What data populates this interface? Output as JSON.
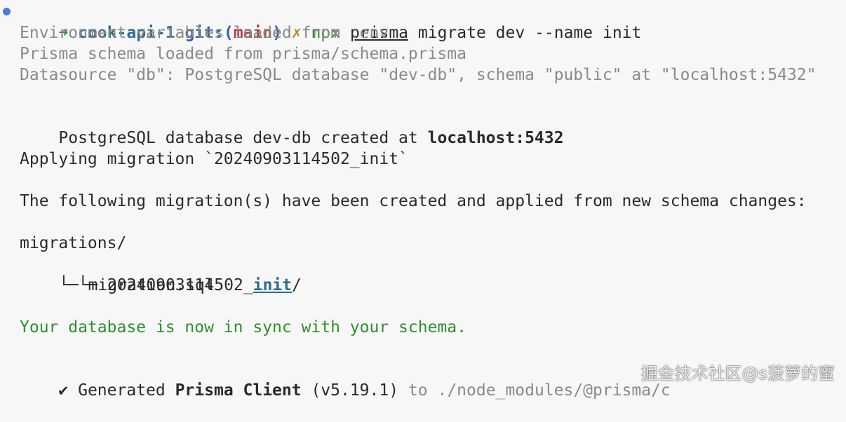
{
  "prompt": {
    "arrow": "➜",
    "directory": "cook-api-1",
    "git_prefix": "git:(",
    "branch": "main",
    "git_suffix": ")",
    "dirty_mark": "✗",
    "command_npx": "npx",
    "command_prisma": "prisma",
    "command_rest": " migrate dev --name init"
  },
  "output": {
    "env_loaded": "Environment variables loaded from .env",
    "schema_loaded": "Prisma schema loaded from prisma/schema.prisma",
    "datasource": "Datasource \"db\": PostgreSQL database \"dev-db\", schema \"public\" at \"localhost:5432\"",
    "db_created_prefix": "PostgreSQL database dev-db created at ",
    "db_created_host": "localhost:5432",
    "applying": "Applying migration `20240903114502_init`",
    "following": "The following migration(s) have been created and applied from new schema changes:",
    "tree_root": "migrations/",
    "tree_branch_prefix": "└─ 20240903114502_",
    "tree_branch_init": "init",
    "tree_branch_suffix": "/",
    "tree_leaf": "└─ migration.sql",
    "in_sync": "Your database is now in sync with your schema.",
    "generated_check": "✔",
    "generated_word": " Generated ",
    "generated_name": "Prisma Client",
    "generated_version": " (v5.19.1)",
    "generated_to": " to ./node_modules/@prisma/c"
  },
  "watermark": "掘金技术社区@s菠萝的蜜",
  "colors": {
    "background": "#f7f7f7",
    "muted": "#8a8a8a",
    "success": "#2f8f2f",
    "directory": "#2b6f8f",
    "branch": "#b33a3a",
    "prompt_dot": "#4b7bd6"
  }
}
